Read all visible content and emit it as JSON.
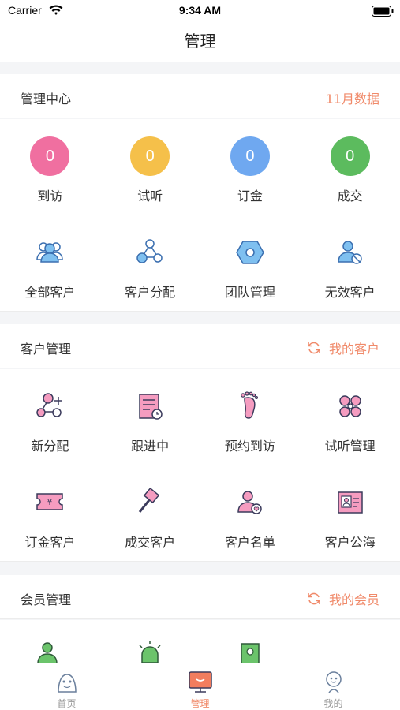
{
  "status": {
    "carrier": "Carrier",
    "time": "9:34 AM"
  },
  "nav": {
    "title": "管理"
  },
  "center": {
    "title": "管理中心",
    "right_label": "11月数据",
    "stats": [
      {
        "value": "0",
        "label": "到访",
        "color": "#f06fa0"
      },
      {
        "value": "0",
        "label": "试听",
        "color": "#f5c04a"
      },
      {
        "value": "0",
        "label": "订金",
        "color": "#6fa8f0"
      },
      {
        "value": "0",
        "label": "成交",
        "color": "#5cbb5e"
      }
    ],
    "actions": [
      {
        "label": "全部客户",
        "icon": "group-icon"
      },
      {
        "label": "客户分配",
        "icon": "share-icon"
      },
      {
        "label": "团队管理",
        "icon": "hexagon-icon"
      },
      {
        "label": "无效客户",
        "icon": "user-blocked-icon"
      }
    ]
  },
  "customers": {
    "title": "客户管理",
    "right_label": "我的客户",
    "row1": [
      {
        "label": "新分配",
        "icon": "new-assign-icon"
      },
      {
        "label": "跟进中",
        "icon": "document-clock-icon"
      },
      {
        "label": "预约到访",
        "icon": "footprint-icon"
      },
      {
        "label": "试听管理",
        "icon": "clover-icon"
      }
    ],
    "row2": [
      {
        "label": "订金客户",
        "icon": "yen-ticket-icon"
      },
      {
        "label": "成交客户",
        "icon": "gavel-icon"
      },
      {
        "label": "客户名单",
        "icon": "user-heart-icon"
      },
      {
        "label": "客户公海",
        "icon": "contact-card-icon"
      }
    ]
  },
  "members": {
    "title": "会员管理",
    "right_label": "我的会员"
  },
  "tabs": [
    {
      "label": "首页",
      "icon": "home-tab-icon"
    },
    {
      "label": "管理",
      "icon": "manage-tab-icon"
    },
    {
      "label": "我的",
      "icon": "profile-tab-icon"
    }
  ],
  "colors": {
    "accent": "#f08a6a",
    "blue_icon": "#5aa0e6",
    "pink_icon": "#f06fa0"
  }
}
